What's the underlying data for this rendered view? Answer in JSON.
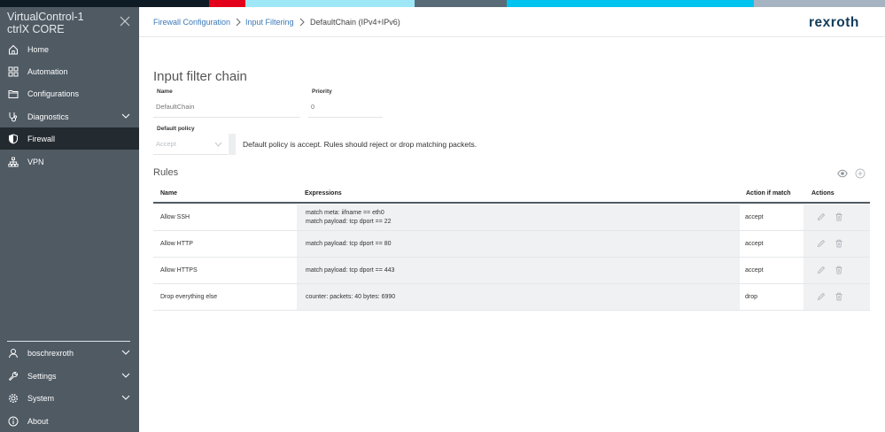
{
  "colors": {
    "sidebar_bg": "#4f5a63",
    "sidebar_active_bg": "#232a30",
    "link": "#3b79b8",
    "logo": "#123c5a",
    "stripe": [
      "#0f1b24",
      "#e2001a",
      "#9ee7f7",
      "#5a6b78",
      "#00c3f0",
      "#a5b4c0"
    ]
  },
  "sidebar": {
    "title_line1": "VirtualControl-1",
    "title_line2": "ctrlX CORE",
    "items": [
      {
        "label": "Home",
        "icon": "home-icon"
      },
      {
        "label": "Automation",
        "icon": "grid-icon"
      },
      {
        "label": "Configurations",
        "icon": "folder-icon"
      },
      {
        "label": "Diagnostics",
        "icon": "stethoscope-icon",
        "expandable": true
      },
      {
        "label": "Firewall",
        "icon": "shield-icon",
        "active": true
      },
      {
        "label": "VPN",
        "icon": "network-icon"
      }
    ],
    "bottom_items": [
      {
        "label": "boschrexroth",
        "icon": "user-icon",
        "expandable": true
      },
      {
        "label": "Settings",
        "icon": "wrench-icon",
        "expandable": true
      },
      {
        "label": "System",
        "icon": "gear-icon",
        "expandable": true
      },
      {
        "label": "About",
        "icon": "info-icon"
      }
    ]
  },
  "breadcrumb": {
    "items": [
      "Firewall Configuration",
      "Input Filtering",
      "DefaultChain (IPv4+IPv6)"
    ]
  },
  "logo": "rexroth",
  "form": {
    "title": "Input filter chain",
    "name_label": "Name",
    "name_placeholder": "DefaultChain",
    "priority_label": "Priority",
    "priority_placeholder": "0",
    "policy_label": "Default policy",
    "policy_value": "Accept",
    "policy_hint": "Default policy is accept. Rules should reject or drop matching packets."
  },
  "rules": {
    "title": "Rules",
    "columns": [
      "Name",
      "Expressions",
      "Action if match",
      "Actions"
    ],
    "rows": [
      {
        "name": "Allow SSH",
        "expressions": [
          "match meta: iifname == eth0",
          "match payload: tcp dport == 22"
        ],
        "action": "accept"
      },
      {
        "name": "Allow HTTP",
        "expressions": [
          "match payload: tcp dport == 80"
        ],
        "action": "accept"
      },
      {
        "name": "Allow HTTPS",
        "expressions": [
          "match payload: tcp dport == 443"
        ],
        "action": "accept"
      },
      {
        "name": "Drop everything else",
        "expressions": [
          "counter: packets: 40 bytes: 6990"
        ],
        "action": "drop"
      }
    ]
  }
}
